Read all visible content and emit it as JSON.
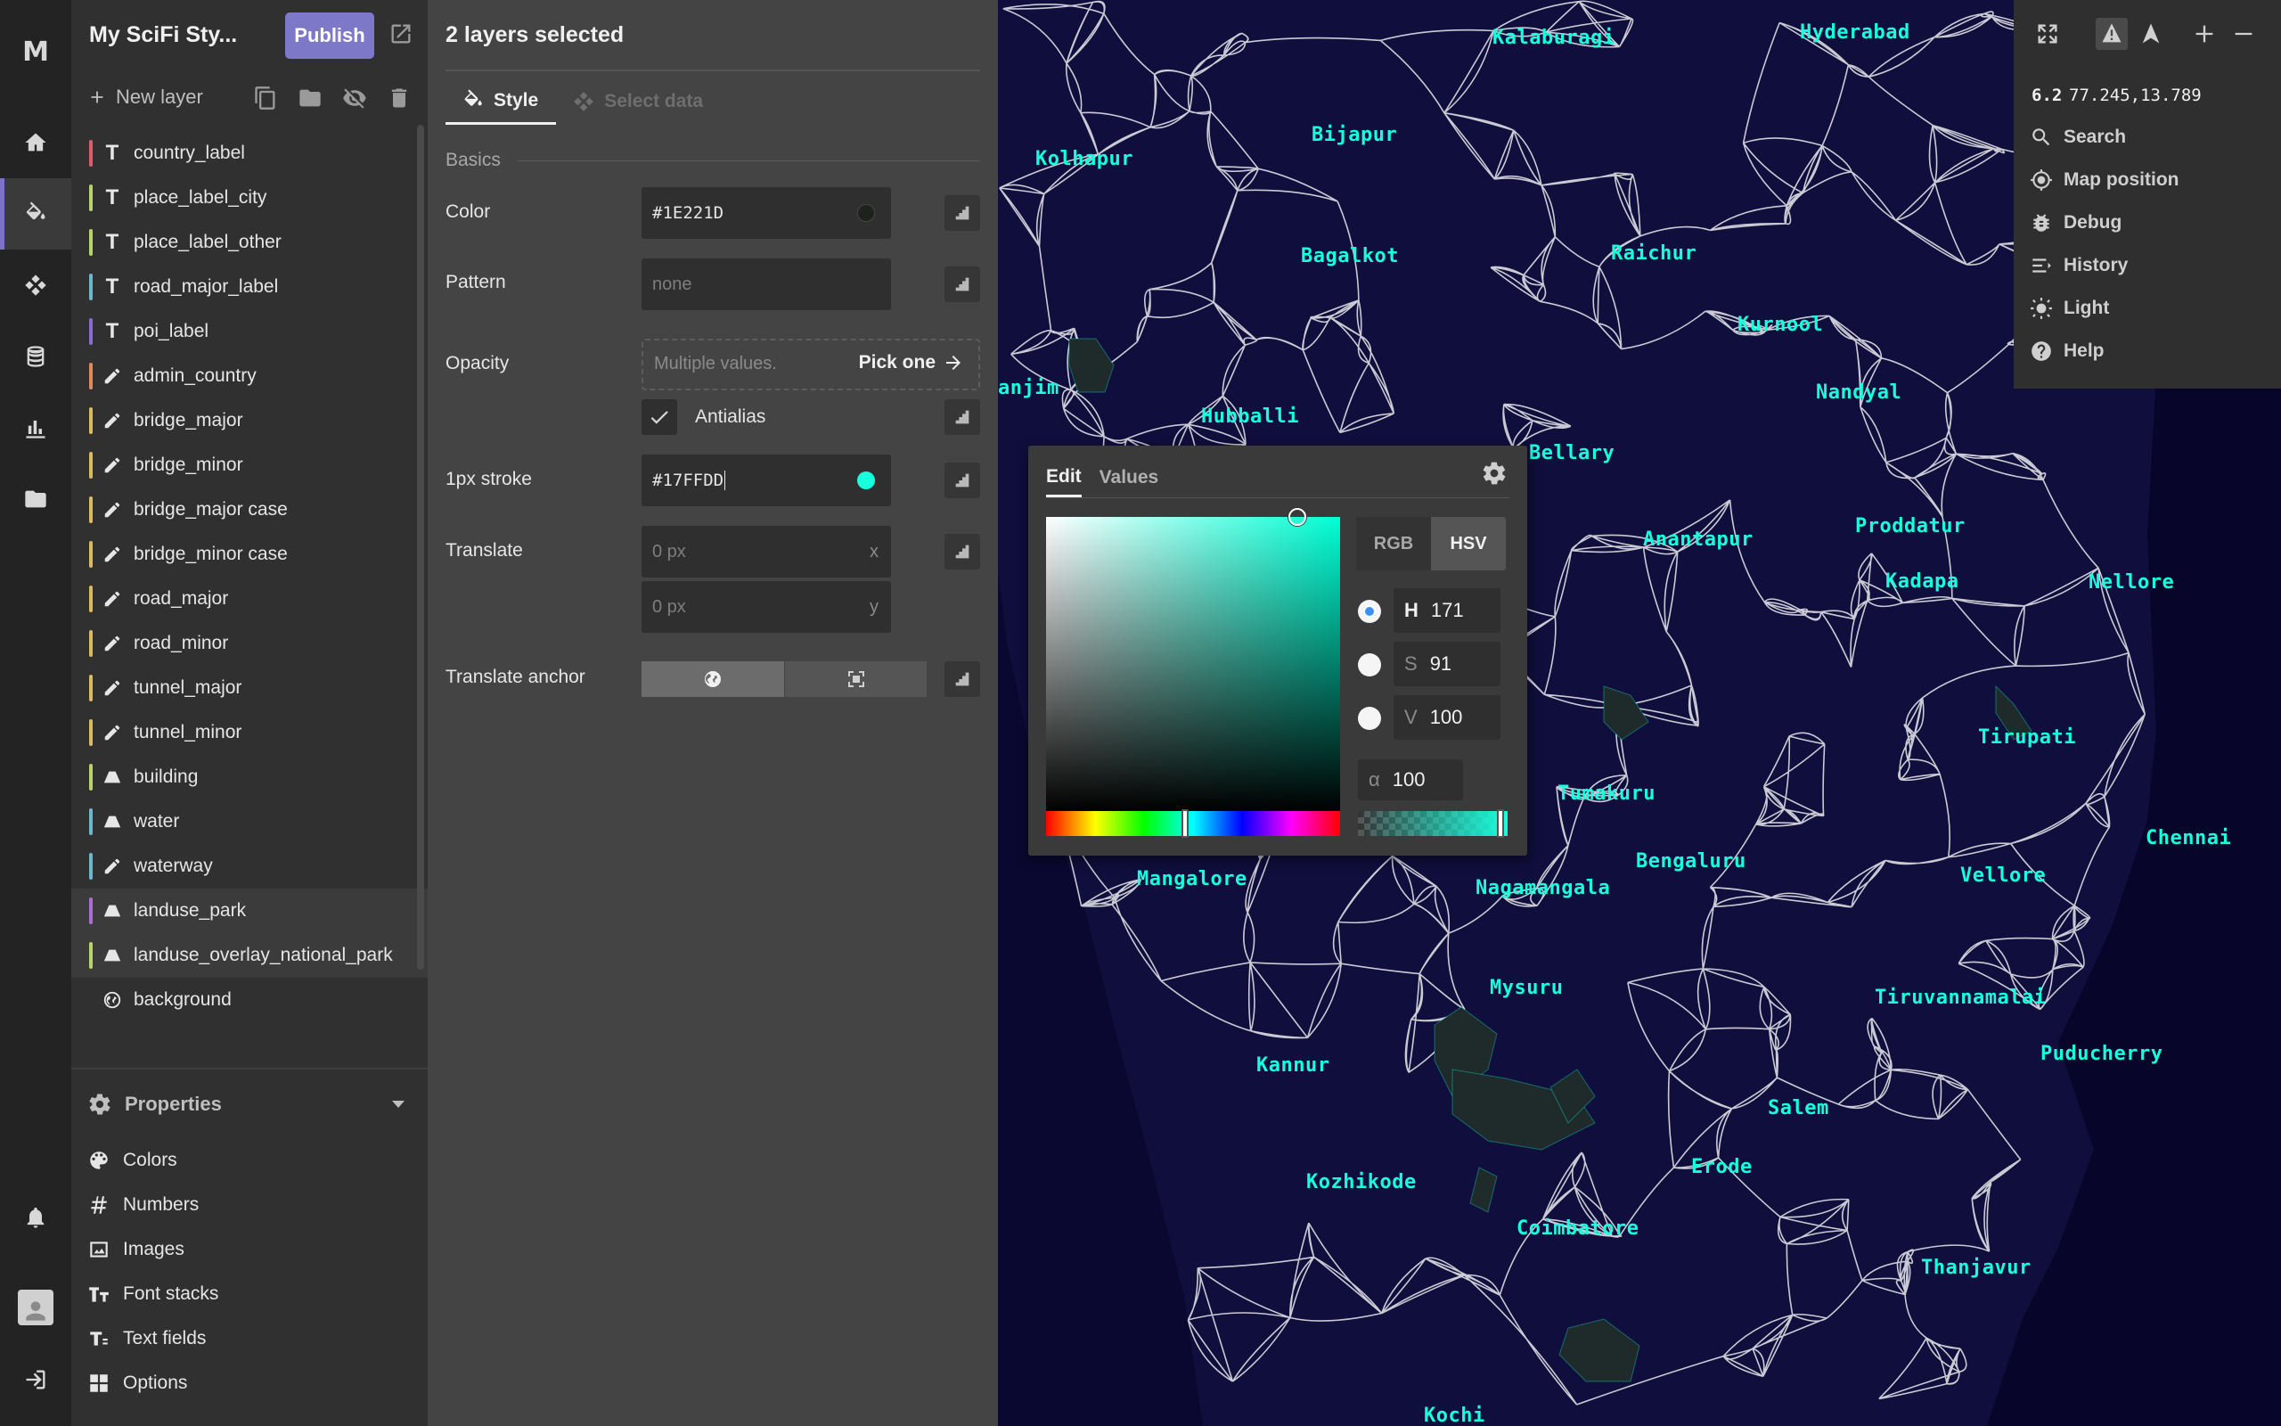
{
  "app": {
    "logo": "M",
    "style_name": "My SciFi Sty...",
    "publish_label": "Publish"
  },
  "rail": {
    "items": [
      {
        "name": "home-icon"
      },
      {
        "name": "paint-bucket-icon",
        "active": true
      },
      {
        "name": "tileset-icon"
      },
      {
        "name": "database-icon"
      },
      {
        "name": "chart-icon"
      },
      {
        "name": "folder-icon"
      }
    ],
    "bottom": [
      {
        "name": "bell-icon"
      },
      {
        "name": "avatar"
      },
      {
        "name": "logout-icon"
      }
    ]
  },
  "layers": {
    "new_layer_label": "New layer",
    "items": [
      {
        "label": "country_label",
        "type": "text",
        "color": "#e05a6a",
        "selected": false
      },
      {
        "label": "place_label_city",
        "type": "text",
        "color": "#b7d36a",
        "selected": false
      },
      {
        "label": "place_label_other",
        "type": "text",
        "color": "#b7d36a",
        "selected": false
      },
      {
        "label": "road_major_label",
        "type": "text",
        "color": "#6ab6d3",
        "selected": false
      },
      {
        "label": "poi_label",
        "type": "text",
        "color": "#8a6ad3",
        "selected": false
      },
      {
        "label": "admin_country",
        "type": "line",
        "color": "#e08a5a",
        "selected": false
      },
      {
        "label": "bridge_major",
        "type": "line",
        "color": "#e0b85a",
        "selected": false
      },
      {
        "label": "bridge_minor",
        "type": "line",
        "color": "#e0b85a",
        "selected": false
      },
      {
        "label": "bridge_major case",
        "type": "line",
        "color": "#e0b85a",
        "selected": false
      },
      {
        "label": "bridge_minor case",
        "type": "line",
        "color": "#e0b85a",
        "selected": false
      },
      {
        "label": "road_major",
        "type": "line",
        "color": "#e0b85a",
        "selected": false
      },
      {
        "label": "road_minor",
        "type": "line",
        "color": "#e0b85a",
        "selected": false
      },
      {
        "label": "tunnel_major",
        "type": "line",
        "color": "#e0b85a",
        "selected": false
      },
      {
        "label": "tunnel_minor",
        "type": "line",
        "color": "#e0b85a",
        "selected": false
      },
      {
        "label": "building",
        "type": "fill",
        "color": "#b7d36a",
        "selected": false
      },
      {
        "label": "water",
        "type": "fill",
        "color": "#6ab6d3",
        "selected": false
      },
      {
        "label": "waterway",
        "type": "line",
        "color": "#6ab6d3",
        "selected": false
      },
      {
        "label": "landuse_park",
        "type": "fill",
        "color": "#b06ad3",
        "selected": true
      },
      {
        "label": "landuse_overlay_national_park",
        "type": "fill",
        "color": "#b7d36a",
        "selected": true
      },
      {
        "label": "background",
        "type": "background",
        "color": "",
        "selected": false
      }
    ]
  },
  "properties": {
    "header": "Properties",
    "items": [
      {
        "label": "Colors",
        "icon": "palette-icon"
      },
      {
        "label": "Numbers",
        "icon": "hash-icon"
      },
      {
        "label": "Images",
        "icon": "image-icon"
      },
      {
        "label": "Font stacks",
        "icon": "font-icon"
      },
      {
        "label": "Text fields",
        "icon": "text-field-icon"
      },
      {
        "label": "Options",
        "icon": "grid-icon"
      }
    ]
  },
  "style_panel": {
    "title": "2 layers selected",
    "tabs": {
      "style": "Style",
      "select_data": "Select data"
    },
    "section": "Basics",
    "color": {
      "label": "Color",
      "value": "#1E221D",
      "swatch": "#1e221d"
    },
    "pattern": {
      "label": "Pattern",
      "placeholder": "none"
    },
    "opacity": {
      "label": "Opacity",
      "placeholder": "Multiple values.",
      "action": "Pick one"
    },
    "antialias": {
      "label": "Antialias",
      "checked": true
    },
    "stroke": {
      "label": "1px stroke",
      "value": "#17FFDD",
      "swatch": "#17ffdd"
    },
    "translate": {
      "label": "Translate",
      "x_placeholder": "0 px",
      "x_suffix": "x",
      "y_placeholder": "0 px",
      "y_suffix": "y"
    },
    "translate_anchor": {
      "label": "Translate anchor",
      "options": [
        "map",
        "viewport"
      ],
      "selected": "map"
    }
  },
  "color_picker": {
    "tabs": {
      "edit": "Edit",
      "values": "Values"
    },
    "modes": {
      "rgb": "RGB",
      "hsv": "HSV",
      "selected": "HSV"
    },
    "h": {
      "key": "H",
      "value": "171"
    },
    "s": {
      "key": "S",
      "value": "91"
    },
    "v": {
      "key": "V",
      "value": "100"
    },
    "alpha": {
      "key": "α",
      "value": "100"
    },
    "hue_color": "#00ffd5",
    "color": "#17ffdd"
  },
  "map_controls": {
    "zoom": "6.2",
    "coords": "77.245,13.789",
    "menu": [
      {
        "label": "Search",
        "icon": "search-icon"
      },
      {
        "label": "Map position",
        "icon": "crosshair-icon"
      },
      {
        "label": "Debug",
        "icon": "bug-icon"
      },
      {
        "label": "History",
        "icon": "history-icon"
      },
      {
        "label": "Light",
        "icon": "sun-icon"
      },
      {
        "label": "Help",
        "icon": "help-icon"
      }
    ]
  },
  "map": {
    "label_color": "#17ffdd",
    "background": "#0a0830",
    "cities": [
      "Kalaburagi",
      "Hyderabad",
      "Bijapur",
      "Kolhapur",
      "Bagalkot",
      "Raichur",
      "Kurnool",
      "Nandyal",
      "Hubballi",
      "Bellary",
      "anjim",
      "Proddatur",
      "Anantapur",
      "Kadapa",
      "Nellore",
      "Tirupati",
      "Tumakuru",
      "Chennai",
      "Mangalore",
      "Nagamangala",
      "Bengaluru",
      "Vellore",
      "Mysuru",
      "Tiruvannamalai",
      "Kannur",
      "Puducherry",
      "Salem",
      "Erode",
      "Kozhikode",
      "Coimbatore",
      "Thanjavur",
      "Kochi"
    ]
  }
}
